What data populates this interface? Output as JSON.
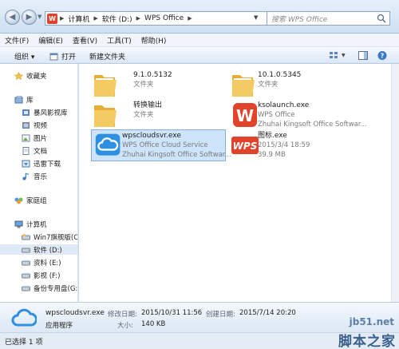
{
  "address_bar": {
    "crumbs": [
      "计算机",
      "软件 (D:)",
      "WPS Office"
    ],
    "search_placeholder": "搜索 WPS Office"
  },
  "menu": [
    "文件(F)",
    "编辑(E)",
    "查看(V)",
    "工具(T)",
    "帮助(H)"
  ],
  "toolbar": {
    "organize": "组织 ▾",
    "print": "打开",
    "new_folder": "新建文件夹"
  },
  "nav": {
    "favorites": "收藏夹",
    "library": "库",
    "library_items": [
      "暴风影视库",
      "视频",
      "图片",
      "文档",
      "迅雷下载",
      "音乐"
    ],
    "homegroup": "家庭组",
    "computer": "计算机",
    "drives": [
      "Win7旗舰版(C:)",
      "软件 (D:)",
      "资料 (E:)",
      "影视 (F:)",
      "备份专用盘(G:)"
    ]
  },
  "files": [
    {
      "name": "9.1.0.5132",
      "line2": "文件夹",
      "line3": "",
      "type": "folder"
    },
    {
      "name": "10.1.0.5345",
      "line2": "文件夹",
      "line3": "",
      "type": "folder"
    },
    {
      "name": "转换输出",
      "line2": "文件夹",
      "line3": "",
      "type": "folder"
    },
    {
      "name": "ksolaunch.exe",
      "line2": "WPS Office",
      "line3": "Zhuhai Kingsoft Office Softwar...",
      "type": "wps-w"
    },
    {
      "name": "wpscloudsvr.exe",
      "line2": "WPS Office Cloud Service",
      "line3": "Zhuhai Kingsoft Office Softwar...",
      "type": "cloud"
    },
    {
      "name": "图标.exe",
      "line2": "2015/3/4 18:59",
      "line3": "39.9 MB",
      "type": "wps-logo"
    }
  ],
  "details": {
    "name": "wpscloudsvr.exe",
    "type": "应用程序",
    "modified_label": "修改日期:",
    "modified_value": "2015/10/31 11:56",
    "created_label": "创建日期:",
    "created_value": "2015/7/14 20:20",
    "size_label": "大小:",
    "size_value": "140 KB"
  },
  "status": "已选择 1 项",
  "watermark": {
    "domain": "jb51.net",
    "text": "脚本之家"
  },
  "colors": {
    "selection": "#cde4fb",
    "folder": "#f2c14e",
    "wps_red": "#e0432a",
    "cloud_blue": "#2f8fe0"
  }
}
